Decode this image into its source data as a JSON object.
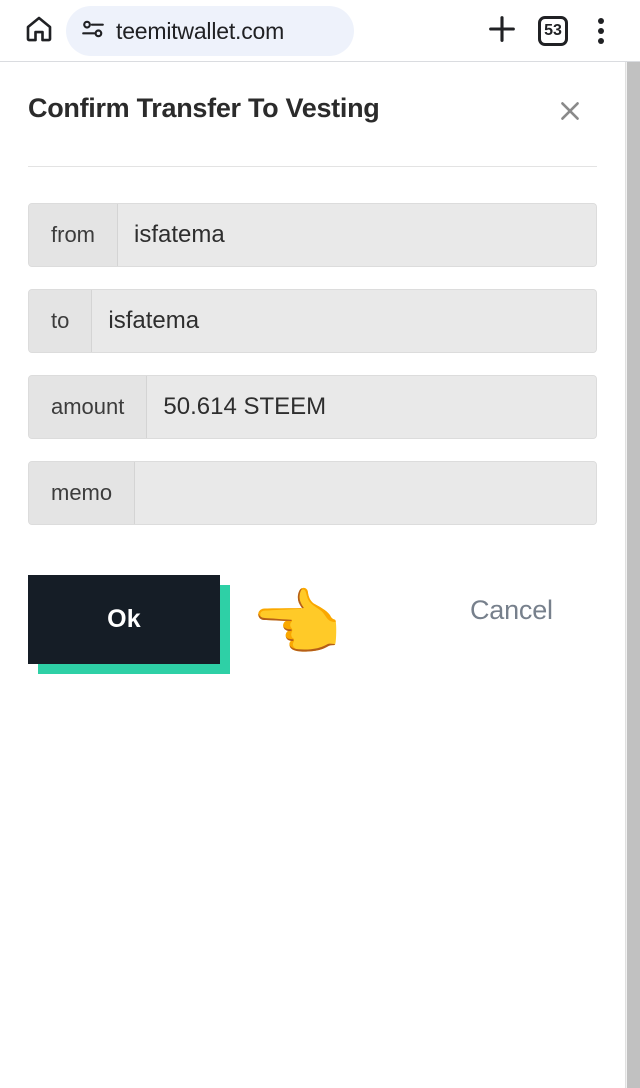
{
  "browser": {
    "home_icon": "home-icon",
    "site_settings_icon": "tune-icon",
    "url": "teemitwallet.com",
    "new_tab_icon": "plus-icon",
    "tab_count": "53",
    "menu_icon": "more-vertical-icon"
  },
  "dialog": {
    "title": "Confirm Transfer To Vesting",
    "close_icon": "close-icon",
    "fields": [
      {
        "label": "from",
        "value": "isfatema"
      },
      {
        "label": "to",
        "value": "isfatema"
      },
      {
        "label": "amount",
        "value": "50.614 STEEM"
      },
      {
        "label": "memo",
        "value": ""
      }
    ],
    "ok_label": "Ok",
    "cancel_label": "Cancel",
    "pointer_emoji": "👈"
  },
  "colors": {
    "ok_button_bg": "#151d26",
    "ok_button_shadow": "#2ed0a6",
    "cancel_text": "#77808c",
    "field_label_bg": "#e4e4e4",
    "field_value_bg": "#e9e9e9",
    "omnibox_bg": "#eef2fb"
  }
}
